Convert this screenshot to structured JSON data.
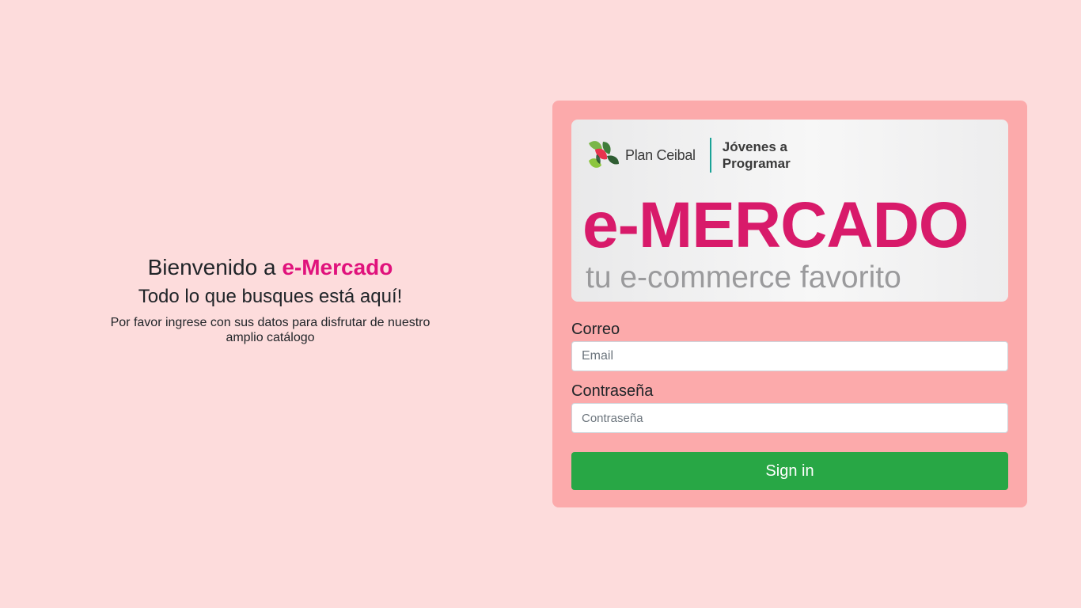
{
  "welcome": {
    "greeting_prefix": "Bienvenido a ",
    "brand": "e-Mercado",
    "subtitle": "Todo lo que busques está aquí!",
    "description": "Por favor ingrese con sus datos para disfrutar de nuestro amplio catálogo"
  },
  "banner": {
    "org_name": "Plan Ceibal",
    "program_name": "Jóvenes a\nProgramar",
    "title": "e-MERCADO",
    "tagline": "tu e-commerce favorito"
  },
  "login": {
    "email_label": "Correo",
    "email_placeholder": "Email",
    "password_label": "Contraseña",
    "password_placeholder": "Contraseña",
    "submit_label": "Sign in"
  },
  "colors": {
    "page_background": "#fddcdc",
    "card_background": "#fcaaab",
    "brand_pink": "#e0127c",
    "title_pink": "#d81a6a",
    "signin_green": "#28a745",
    "divider_teal": "#1aa396"
  },
  "icons": {
    "logo": "plan-ceibal-logo-icon"
  }
}
